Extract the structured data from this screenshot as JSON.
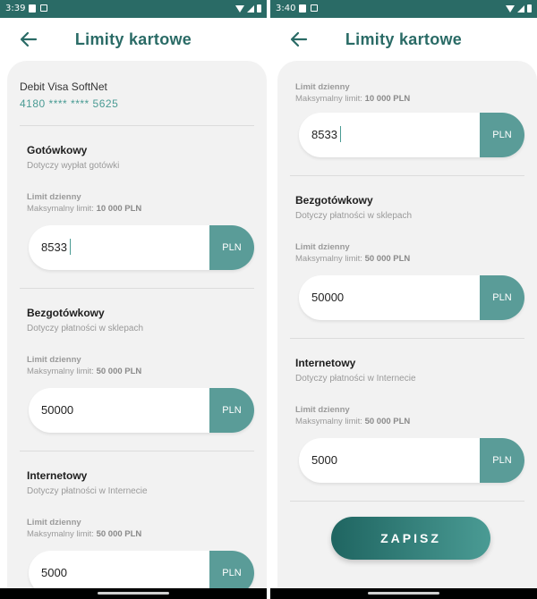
{
  "colors": {
    "brand": "#2a6b66",
    "accent": "#5a9c98",
    "sheet": "#f2f2f2"
  },
  "icons": {
    "back": "arrow-left-icon",
    "wifi": "wifi-icon",
    "signal": "signal-icon",
    "battery": "battery-icon",
    "notification": "notification-icon"
  },
  "left": {
    "status_time": "3:39",
    "title": "Limity kartowe",
    "card": {
      "name": "Debit Visa SoftNet",
      "number": "4180 **** **** 5625"
    },
    "sections": [
      {
        "title": "Gotówkowy",
        "desc": "Dotyczy wypłat gotówki",
        "limit_label": "Limit dzienny",
        "max_prefix": "Maksymalny limit:",
        "max_value": "10 000 PLN",
        "value": "8533",
        "unit": "PLN"
      },
      {
        "title": "Bezgotówkowy",
        "desc": "Dotyczy płatności w sklepach",
        "limit_label": "Limit dzienny",
        "max_prefix": "Maksymalny limit:",
        "max_value": "50 000 PLN",
        "value": "50000",
        "unit": "PLN"
      },
      {
        "title": "Internetowy",
        "desc": "Dotyczy płatności w Internecie",
        "limit_label": "Limit dzienny",
        "max_prefix": "Maksymalny limit:",
        "max_value": "50 000 PLN",
        "value": "5000",
        "unit": "PLN"
      }
    ]
  },
  "right": {
    "status_time": "3:40",
    "title": "Limity kartowe",
    "first_limit": {
      "limit_label": "Limit dzienny",
      "max_prefix": "Maksymalny limit:",
      "max_value": "10 000 PLN",
      "value": "8533",
      "unit": "PLN"
    },
    "sections": [
      {
        "title": "Bezgotówkowy",
        "desc": "Dotyczy płatności w sklepach",
        "limit_label": "Limit dzienny",
        "max_prefix": "Maksymalny limit:",
        "max_value": "50 000 PLN",
        "value": "50000",
        "unit": "PLN"
      },
      {
        "title": "Internetowy",
        "desc": "Dotyczy płatności w Internecie",
        "limit_label": "Limit dzienny",
        "max_prefix": "Maksymalny limit:",
        "max_value": "50 000 PLN",
        "value": "5000",
        "unit": "PLN"
      }
    ],
    "save_label": "ZAPISZ"
  }
}
